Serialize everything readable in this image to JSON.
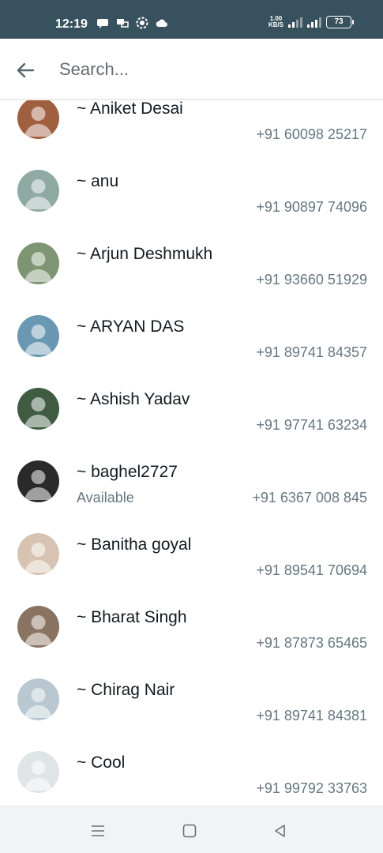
{
  "status_bar": {
    "time": "12:19",
    "net_speed_value": "1.00",
    "net_speed_unit": "KB/S",
    "battery": "73",
    "icons": [
      "chat-bubble-icon",
      "chat-icon",
      "settings-icon",
      "cloud-icon"
    ]
  },
  "search": {
    "placeholder": "Search...",
    "value": ""
  },
  "contacts": [
    {
      "name": "~ Aniket Desai",
      "status": "",
      "phone": "+91 60098 25217",
      "avatar_color": "#a0603f"
    },
    {
      "name": "~ anu",
      "status": "",
      "phone": "+91 90897 74096",
      "avatar_color": "#8fa9a3"
    },
    {
      "name": "~ Arjun Deshmukh",
      "status": "",
      "phone": "+91 93660 51929",
      "avatar_color": "#7f9473"
    },
    {
      "name": "~ ARYAN DAS",
      "status": "",
      "phone": "+91 89741 84357",
      "avatar_color": "#6a98b3"
    },
    {
      "name": "~ Ashish Yadav",
      "status": "",
      "phone": "+91 97741 63234",
      "avatar_color": "#3f5c43"
    },
    {
      "name": "~ baghel2727",
      "status": "Available",
      "phone": "+91 6367 008 845",
      "avatar_color": "#2a2a2a"
    },
    {
      "name": "~ Banitha goyal",
      "status": "",
      "phone": "+91 89541 70694",
      "avatar_color": "#d8c3b2"
    },
    {
      "name": "~ Bharat Singh",
      "status": "",
      "phone": "+91 87873 65465",
      "avatar_color": "#8a7360"
    },
    {
      "name": "~ Chirag Nair",
      "status": "",
      "phone": "+91 89741 84381",
      "avatar_color": "#b9c7d1"
    },
    {
      "name": "~ Cool",
      "status": "",
      "phone": "+91 99792 33763",
      "avatar_color": "#dfe5e7"
    }
  ]
}
